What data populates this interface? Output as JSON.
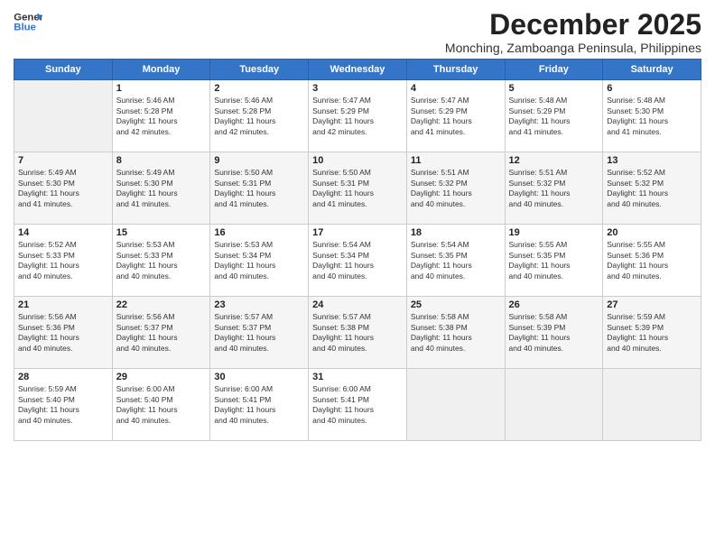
{
  "header": {
    "logo_line1": "General",
    "logo_line2": "Blue",
    "title": "December 2025",
    "subtitle": "Monching, Zamboanga Peninsula, Philippines"
  },
  "calendar": {
    "days_of_week": [
      "Sunday",
      "Monday",
      "Tuesday",
      "Wednesday",
      "Thursday",
      "Friday",
      "Saturday"
    ],
    "weeks": [
      [
        {
          "day": "",
          "info": ""
        },
        {
          "day": "1",
          "info": "Sunrise: 5:46 AM\nSunset: 5:28 PM\nDaylight: 11 hours\nand 42 minutes."
        },
        {
          "day": "2",
          "info": "Sunrise: 5:46 AM\nSunset: 5:28 PM\nDaylight: 11 hours\nand 42 minutes."
        },
        {
          "day": "3",
          "info": "Sunrise: 5:47 AM\nSunset: 5:29 PM\nDaylight: 11 hours\nand 42 minutes."
        },
        {
          "day": "4",
          "info": "Sunrise: 5:47 AM\nSunset: 5:29 PM\nDaylight: 11 hours\nand 41 minutes."
        },
        {
          "day": "5",
          "info": "Sunrise: 5:48 AM\nSunset: 5:29 PM\nDaylight: 11 hours\nand 41 minutes."
        },
        {
          "day": "6",
          "info": "Sunrise: 5:48 AM\nSunset: 5:30 PM\nDaylight: 11 hours\nand 41 minutes."
        }
      ],
      [
        {
          "day": "7",
          "info": "Sunrise: 5:49 AM\nSunset: 5:30 PM\nDaylight: 11 hours\nand 41 minutes."
        },
        {
          "day": "8",
          "info": "Sunrise: 5:49 AM\nSunset: 5:30 PM\nDaylight: 11 hours\nand 41 minutes."
        },
        {
          "day": "9",
          "info": "Sunrise: 5:50 AM\nSunset: 5:31 PM\nDaylight: 11 hours\nand 41 minutes."
        },
        {
          "day": "10",
          "info": "Sunrise: 5:50 AM\nSunset: 5:31 PM\nDaylight: 11 hours\nand 41 minutes."
        },
        {
          "day": "11",
          "info": "Sunrise: 5:51 AM\nSunset: 5:32 PM\nDaylight: 11 hours\nand 40 minutes."
        },
        {
          "day": "12",
          "info": "Sunrise: 5:51 AM\nSunset: 5:32 PM\nDaylight: 11 hours\nand 40 minutes."
        },
        {
          "day": "13",
          "info": "Sunrise: 5:52 AM\nSunset: 5:32 PM\nDaylight: 11 hours\nand 40 minutes."
        }
      ],
      [
        {
          "day": "14",
          "info": "Sunrise: 5:52 AM\nSunset: 5:33 PM\nDaylight: 11 hours\nand 40 minutes."
        },
        {
          "day": "15",
          "info": "Sunrise: 5:53 AM\nSunset: 5:33 PM\nDaylight: 11 hours\nand 40 minutes."
        },
        {
          "day": "16",
          "info": "Sunrise: 5:53 AM\nSunset: 5:34 PM\nDaylight: 11 hours\nand 40 minutes."
        },
        {
          "day": "17",
          "info": "Sunrise: 5:54 AM\nSunset: 5:34 PM\nDaylight: 11 hours\nand 40 minutes."
        },
        {
          "day": "18",
          "info": "Sunrise: 5:54 AM\nSunset: 5:35 PM\nDaylight: 11 hours\nand 40 minutes."
        },
        {
          "day": "19",
          "info": "Sunrise: 5:55 AM\nSunset: 5:35 PM\nDaylight: 11 hours\nand 40 minutes."
        },
        {
          "day": "20",
          "info": "Sunrise: 5:55 AM\nSunset: 5:36 PM\nDaylight: 11 hours\nand 40 minutes."
        }
      ],
      [
        {
          "day": "21",
          "info": "Sunrise: 5:56 AM\nSunset: 5:36 PM\nDaylight: 11 hours\nand 40 minutes."
        },
        {
          "day": "22",
          "info": "Sunrise: 5:56 AM\nSunset: 5:37 PM\nDaylight: 11 hours\nand 40 minutes."
        },
        {
          "day": "23",
          "info": "Sunrise: 5:57 AM\nSunset: 5:37 PM\nDaylight: 11 hours\nand 40 minutes."
        },
        {
          "day": "24",
          "info": "Sunrise: 5:57 AM\nSunset: 5:38 PM\nDaylight: 11 hours\nand 40 minutes."
        },
        {
          "day": "25",
          "info": "Sunrise: 5:58 AM\nSunset: 5:38 PM\nDaylight: 11 hours\nand 40 minutes."
        },
        {
          "day": "26",
          "info": "Sunrise: 5:58 AM\nSunset: 5:39 PM\nDaylight: 11 hours\nand 40 minutes."
        },
        {
          "day": "27",
          "info": "Sunrise: 5:59 AM\nSunset: 5:39 PM\nDaylight: 11 hours\nand 40 minutes."
        }
      ],
      [
        {
          "day": "28",
          "info": "Sunrise: 5:59 AM\nSunset: 5:40 PM\nDaylight: 11 hours\nand 40 minutes."
        },
        {
          "day": "29",
          "info": "Sunrise: 6:00 AM\nSunset: 5:40 PM\nDaylight: 11 hours\nand 40 minutes."
        },
        {
          "day": "30",
          "info": "Sunrise: 6:00 AM\nSunset: 5:41 PM\nDaylight: 11 hours\nand 40 minutes."
        },
        {
          "day": "31",
          "info": "Sunrise: 6:00 AM\nSunset: 5:41 PM\nDaylight: 11 hours\nand 40 minutes."
        },
        {
          "day": "",
          "info": ""
        },
        {
          "day": "",
          "info": ""
        },
        {
          "day": "",
          "info": ""
        }
      ]
    ]
  }
}
